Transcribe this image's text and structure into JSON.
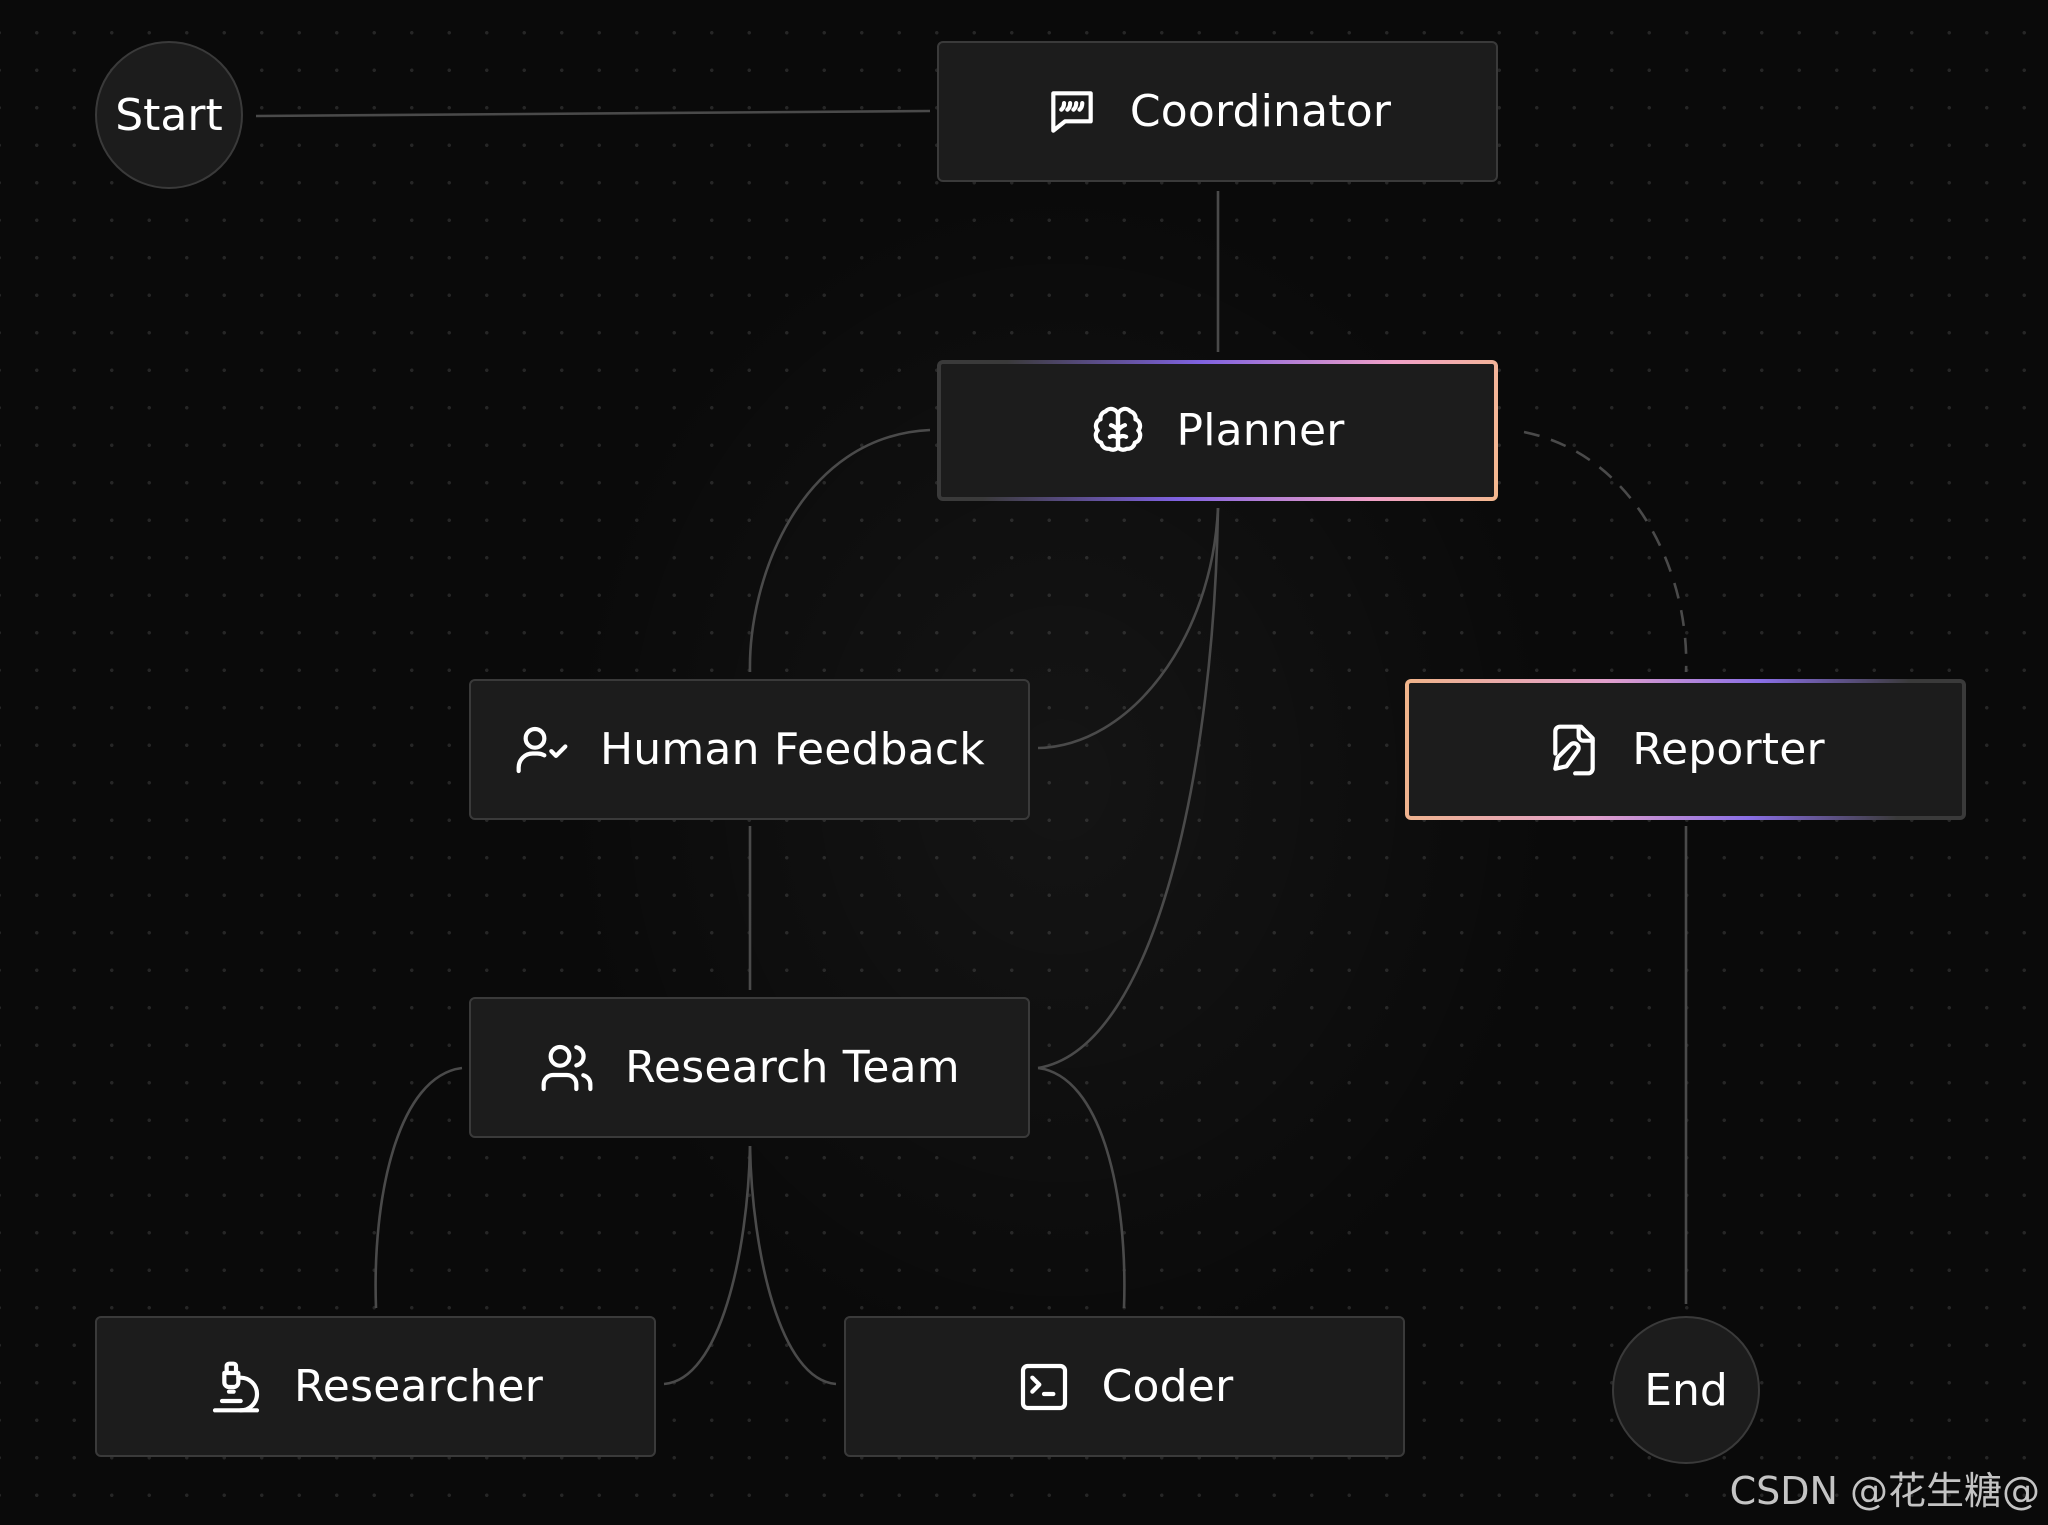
{
  "nodes": {
    "start": {
      "label": "Start"
    },
    "coordinator": {
      "label": "Coordinator",
      "icon": "chat-quote-icon"
    },
    "planner": {
      "label": "Planner",
      "icon": "brain-icon"
    },
    "human_feedback": {
      "label": "Human Feedback",
      "icon": "user-check-icon"
    },
    "reporter": {
      "label": "Reporter",
      "icon": "file-pen-icon"
    },
    "research_team": {
      "label": "Research Team",
      "icon": "users-icon"
    },
    "researcher": {
      "label": "Researcher",
      "icon": "microscope-icon"
    },
    "coder": {
      "label": "Coder",
      "icon": "terminal-square-icon"
    },
    "end": {
      "label": "End"
    }
  },
  "edges": [
    {
      "from": "Start",
      "to": "Coordinator",
      "style": "solid"
    },
    {
      "from": "Coordinator",
      "to": "Planner",
      "style": "solid"
    },
    {
      "from": "Planner",
      "to": "Human Feedback",
      "style": "solid"
    },
    {
      "from": "Human Feedback",
      "to": "Planner",
      "style": "solid"
    },
    {
      "from": "Planner",
      "to": "Research Team",
      "style": "solid"
    },
    {
      "from": "Planner",
      "to": "Reporter",
      "style": "dashed"
    },
    {
      "from": "Human Feedback",
      "to": "Research Team",
      "style": "solid"
    },
    {
      "from": "Research Team",
      "to": "Researcher",
      "style": "solid"
    },
    {
      "from": "Researcher",
      "to": "Research Team",
      "style": "solid"
    },
    {
      "from": "Research Team",
      "to": "Coder",
      "style": "solid"
    },
    {
      "from": "Coder",
      "to": "Research Team",
      "style": "solid"
    },
    {
      "from": "Reporter",
      "to": "End",
      "style": "solid"
    }
  ],
  "highlighted": [
    "Planner",
    "Reporter"
  ],
  "colors": {
    "background": "#0a0a0a",
    "node_fill": "#1c1c1c",
    "node_border": "#3a3a3a",
    "edge": "#4a4a4a",
    "highlight_violet": "#7f62e0",
    "highlight_pink": "#f0a0c8",
    "highlight_peach": "#f4b98e",
    "text": "#ffffff"
  },
  "watermark": "CSDN @花生糖@"
}
